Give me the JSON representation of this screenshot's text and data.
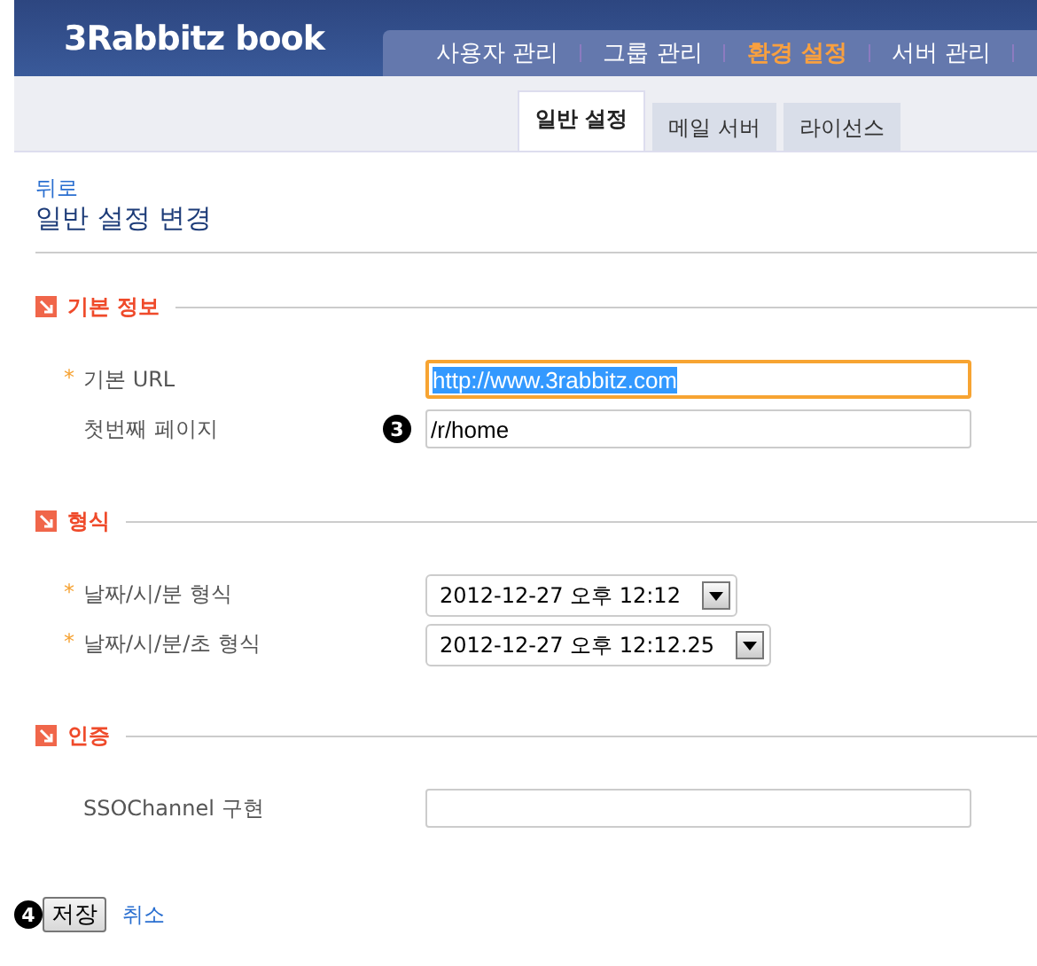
{
  "header": {
    "logo": "3Rabbitz book",
    "nav": [
      {
        "label": "사용자 관리",
        "selected": false
      },
      {
        "label": "그룹 관리",
        "selected": false
      },
      {
        "label": "환경 설정",
        "selected": true
      },
      {
        "label": "서버 관리",
        "selected": false
      }
    ]
  },
  "subtabs": [
    {
      "label": "일반 설정",
      "selected": true
    },
    {
      "label": "메일 서버",
      "selected": false
    },
    {
      "label": "라이선스",
      "selected": false
    }
  ],
  "back_link": "뒤로",
  "title": "일반 설정 변경",
  "sections": [
    {
      "title": "기본 정보",
      "fields": [
        {
          "label": "기본 URL",
          "required_mark": "*",
          "kind": "text",
          "value": "http://www.3rabbitz.com",
          "focused": true
        },
        {
          "label": "첫번째 페이지",
          "kind": "text",
          "value": "/r/home",
          "focused": false,
          "badge": "3"
        }
      ]
    },
    {
      "title": "형식",
      "fields": [
        {
          "label": "날짜/시/분 형식",
          "required_mark": "*",
          "kind": "select",
          "value": "2012-12-27 오후 12:12"
        },
        {
          "label": "날짜/시/분/초 형식",
          "required_mark": "*",
          "kind": "select",
          "value": "2012-12-27 오후 12:12.25"
        }
      ]
    },
    {
      "title": "인증",
      "fields": [
        {
          "label": "SSOChannel 구현",
          "kind": "text",
          "focused": false
        }
      ]
    }
  ],
  "actions": {
    "badge": "4",
    "save": "저장",
    "cancel": "취소"
  }
}
